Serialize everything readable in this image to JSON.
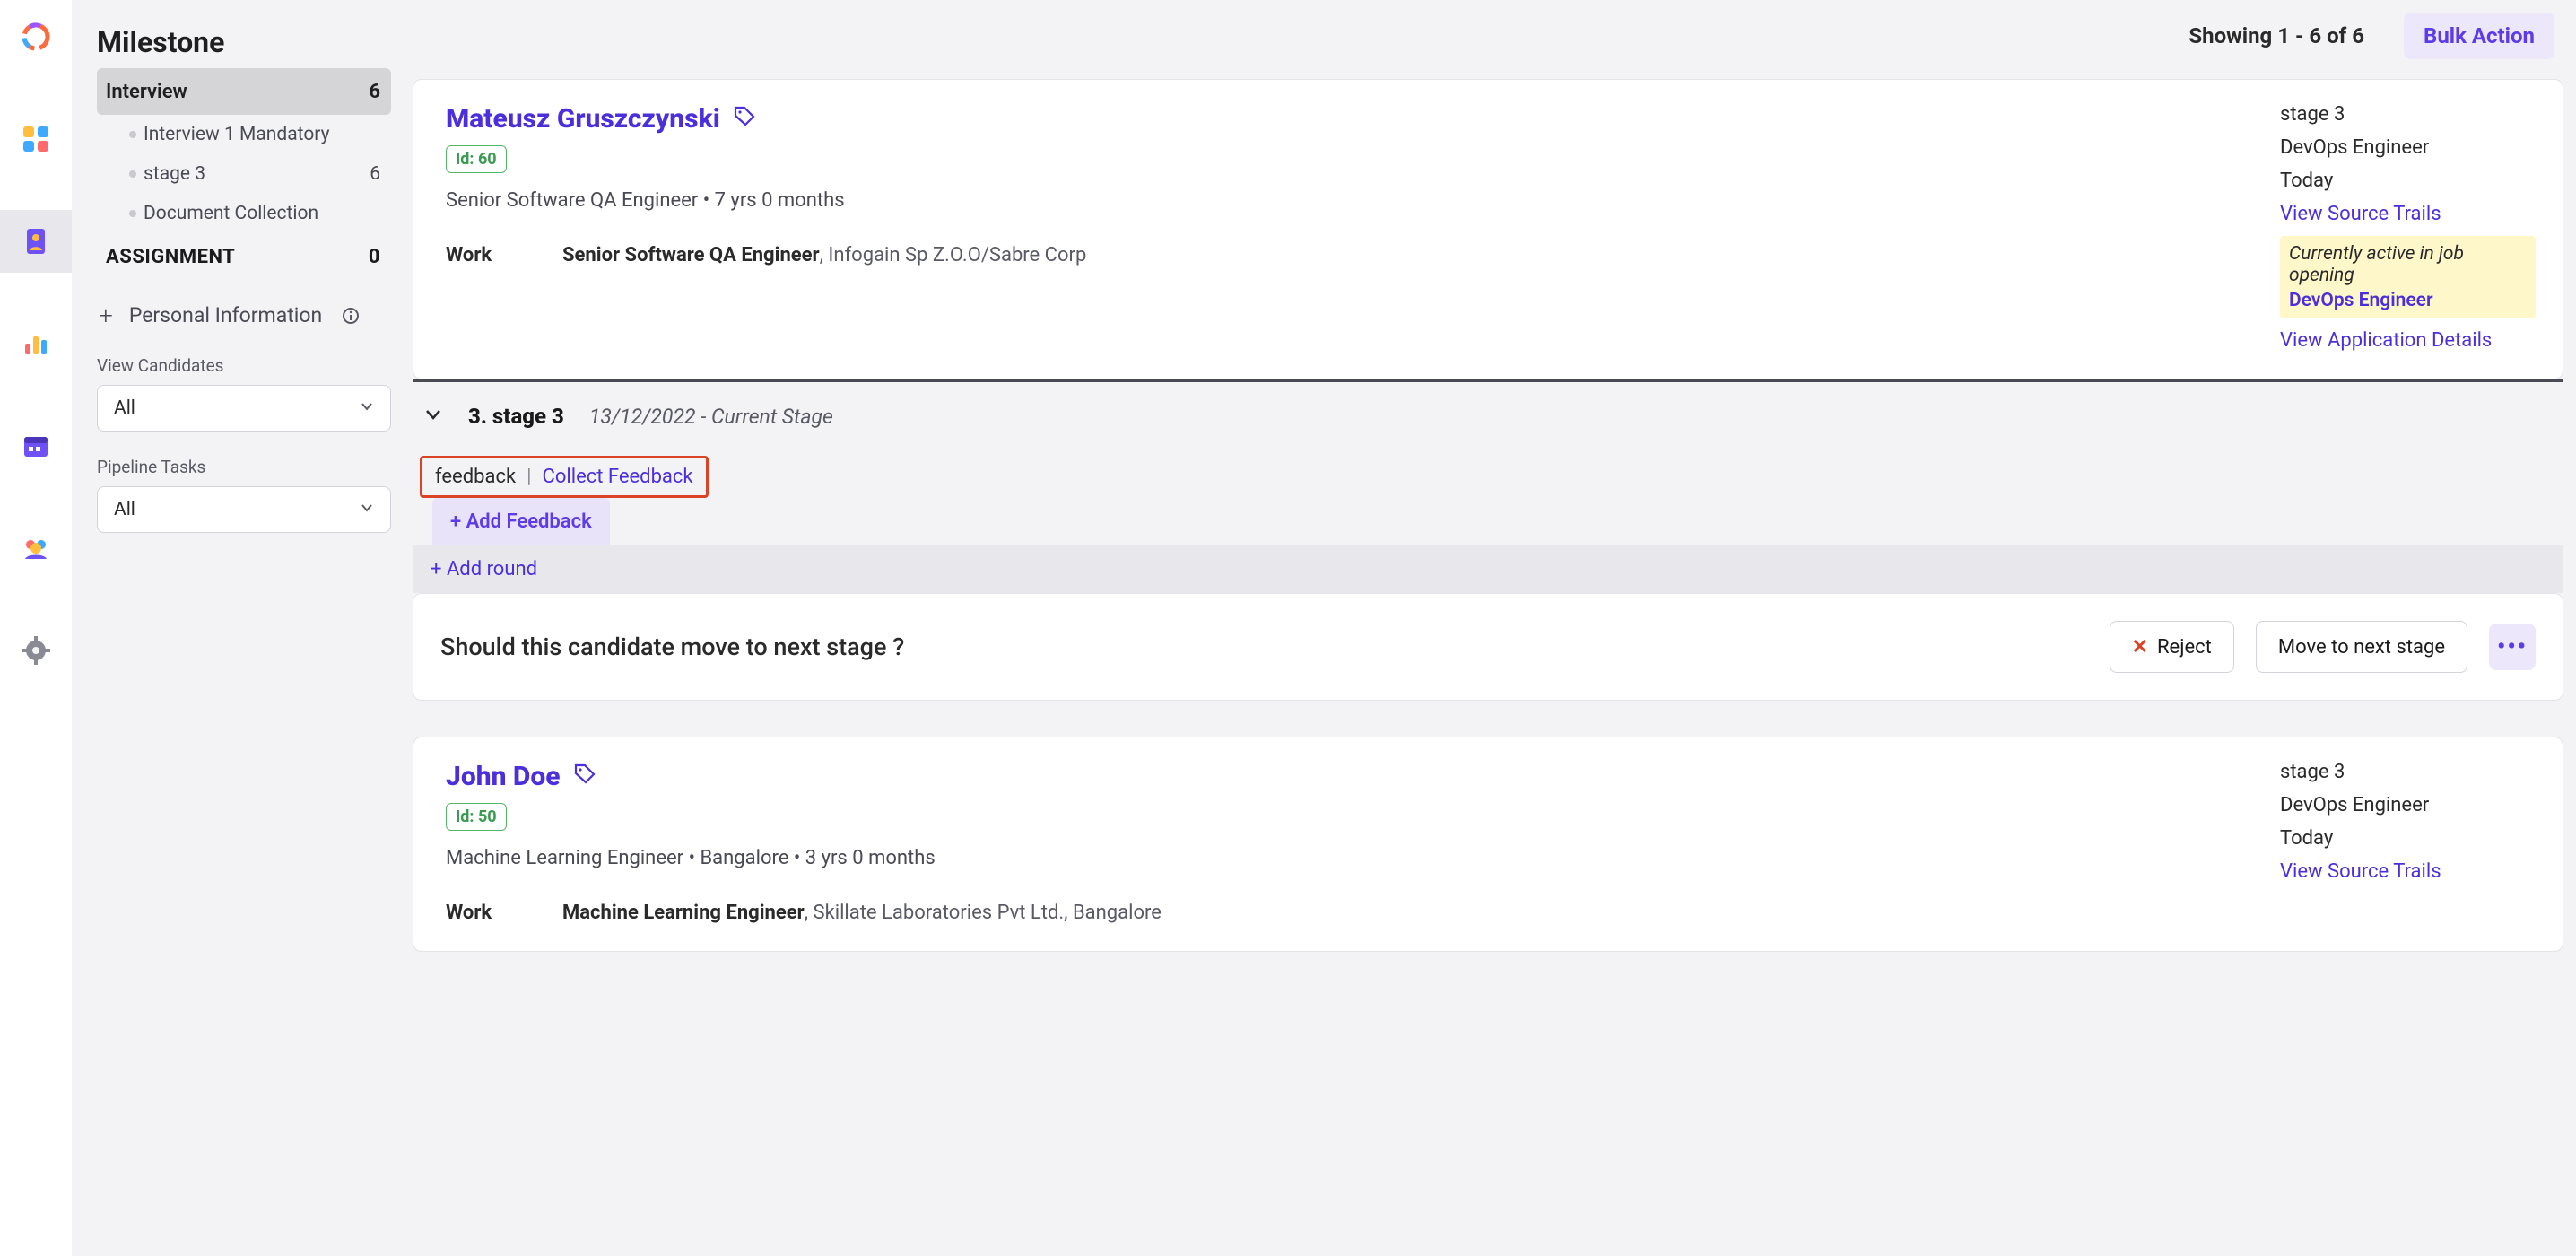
{
  "topbar": {
    "showing": "Showing 1 - 6 of 6",
    "bulk_action": "Bulk Action"
  },
  "sidebar": {
    "heading": "Milestone",
    "interview": {
      "label": "Interview",
      "count": "6"
    },
    "subitems": [
      {
        "label": "Interview 1 Mandatory",
        "count": ""
      },
      {
        "label": "stage 3",
        "count": "6"
      },
      {
        "label": "Document Collection",
        "count": ""
      }
    ],
    "assignment": {
      "label": "ASSIGNMENT",
      "count": "0"
    },
    "personal_info": "Personal Information",
    "view_candidates_label": "View Candidates",
    "view_candidates_value": "All",
    "pipeline_tasks_label": "Pipeline Tasks",
    "pipeline_tasks_value": "All"
  },
  "candidates": [
    {
      "name": "Mateusz Gruszczynski",
      "id_badge": "Id: 60",
      "headline": "Senior Software QA Engineer • 7 yrs 0 months",
      "work_label": "Work",
      "work_role": "Senior Software QA Engineer",
      "work_company": ", Infogain Sp Z.O.O/Sabre Corp",
      "right": {
        "stage": "stage 3",
        "position": "DevOps Engineer",
        "today": "Today",
        "view_source": "View Source Trails",
        "active_line1": "Currently active in job opening",
        "active_line2": "DevOps Engineer",
        "view_app": "View Application Details"
      }
    },
    {
      "name": "John Doe",
      "id_badge": "Id: 50",
      "headline": "Machine Learning Engineer • Bangalore • 3 yrs 0 months",
      "work_label": "Work",
      "work_role": "Machine Learning Engineer",
      "work_company": ", Skillate Laboratories Pvt Ltd., Bangalore",
      "right": {
        "stage": "stage 3",
        "position": "DevOps Engineer",
        "today": "Today",
        "view_source": "View Source Trails"
      }
    }
  ],
  "stage": {
    "title": "3. stage 3",
    "date_note": "13/12/2022 - Current Stage",
    "feedback_label": "feedback",
    "feedback_sep": "|",
    "collect_feedback": "Collect Feedback",
    "add_feedback": "+ Add Feedback",
    "add_round": "+ Add round"
  },
  "decision": {
    "question": "Should this candidate move to next stage ?",
    "reject": "Reject",
    "move": "Move to next stage",
    "dots": "•••"
  }
}
